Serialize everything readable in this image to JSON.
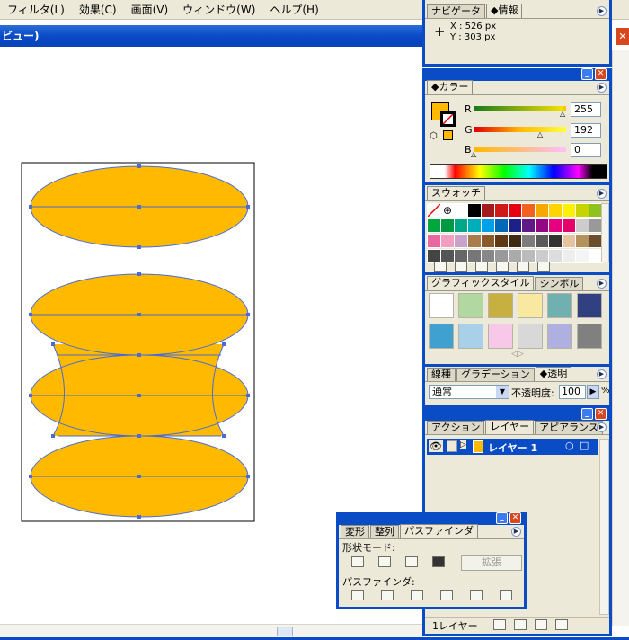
{
  "menu": [
    "フィルタ(L)",
    "効果(C)",
    "画面(V)",
    "ウィンドウ(W)",
    "ヘルプ(H)"
  ],
  "document": {
    "title_fragment": "ビュー)"
  },
  "colors": {
    "fill": "#ffba00",
    "selection": "#4a6cd4",
    "titlebar": "#0a4bc6",
    "panel_bg": "#ece9d8"
  },
  "navigator_panel": {
    "tabs": [
      "ナビゲータ",
      "情報"
    ],
    "active_tab": "情報",
    "crosshair_icon": "crosshair-icon",
    "x": "X : 526 px",
    "y": "Y : 303 px"
  },
  "color_panel": {
    "tab": "カラー",
    "r_label": "R",
    "r_value": "255",
    "g_label": "G",
    "g_value": "192",
    "b_label": "B",
    "b_value": "0",
    "fill_color": "#ffba00"
  },
  "swatches_panel": {
    "tab": "スウォッチ",
    "rows": [
      [
        "none",
        "reg",
        "#ffffff",
        "#000000",
        "#a51b1b",
        "#d01a1a",
        "#e60012",
        "#f0621e",
        "#f6a800",
        "#ffd400",
        "#fff100",
        "#c8d400",
        "#8dc21f"
      ],
      [
        "#00a73c",
        "#009944",
        "#00a88a",
        "#00aebb",
        "#00a0e9",
        "#0068b7",
        "#1d2088",
        "#601986",
        "#920783",
        "#e4007f",
        "#e5006a",
        "#cccccc",
        "#999999"
      ],
      [
        "#ea68a2",
        "#f19ec2",
        "#c8a2c8",
        "#a97c50",
        "#8b5a2b",
        "#603813",
        "#3f2a14",
        "#7d7d7d",
        "#5a5a5a",
        "#333333",
        "#e6c3a0",
        "#b5915e",
        "#6b4e2e"
      ],
      [
        "#444444",
        "#555555",
        "#666666",
        "#777777",
        "#888888",
        "#999999",
        "#aaaaaa",
        "#bbbbbb",
        "#cccccc",
        "#dddddd",
        "#eeeeee",
        "#f5f5f5",
        "#ffffff"
      ]
    ]
  },
  "graphic_styles_panel": {
    "tabs": [
      "グラフィックスタイル",
      "シンボル"
    ]
  },
  "transparency_panel": {
    "tabs": [
      "線種",
      "グラデーション",
      "透明"
    ],
    "active_tab": "透明",
    "blend_mode": "通常",
    "opacity_label": "不透明度:",
    "opacity_value": "100",
    "opacity_unit": "%"
  },
  "layers_panel": {
    "tabs": [
      "アクション",
      "レイヤー",
      "アピアランス"
    ],
    "active_tab": "レイヤー",
    "layer_name": "レイヤー 1",
    "footer_label": "1レイヤー"
  },
  "pathfinder_panel": {
    "tabs": [
      "変形",
      "整列",
      "パスファインダ"
    ],
    "active_tab": "パスファインダ",
    "shape_mode_label": "形状モード:",
    "expand_label": "拡張",
    "pathfinder_label": "パスファインダ:"
  }
}
